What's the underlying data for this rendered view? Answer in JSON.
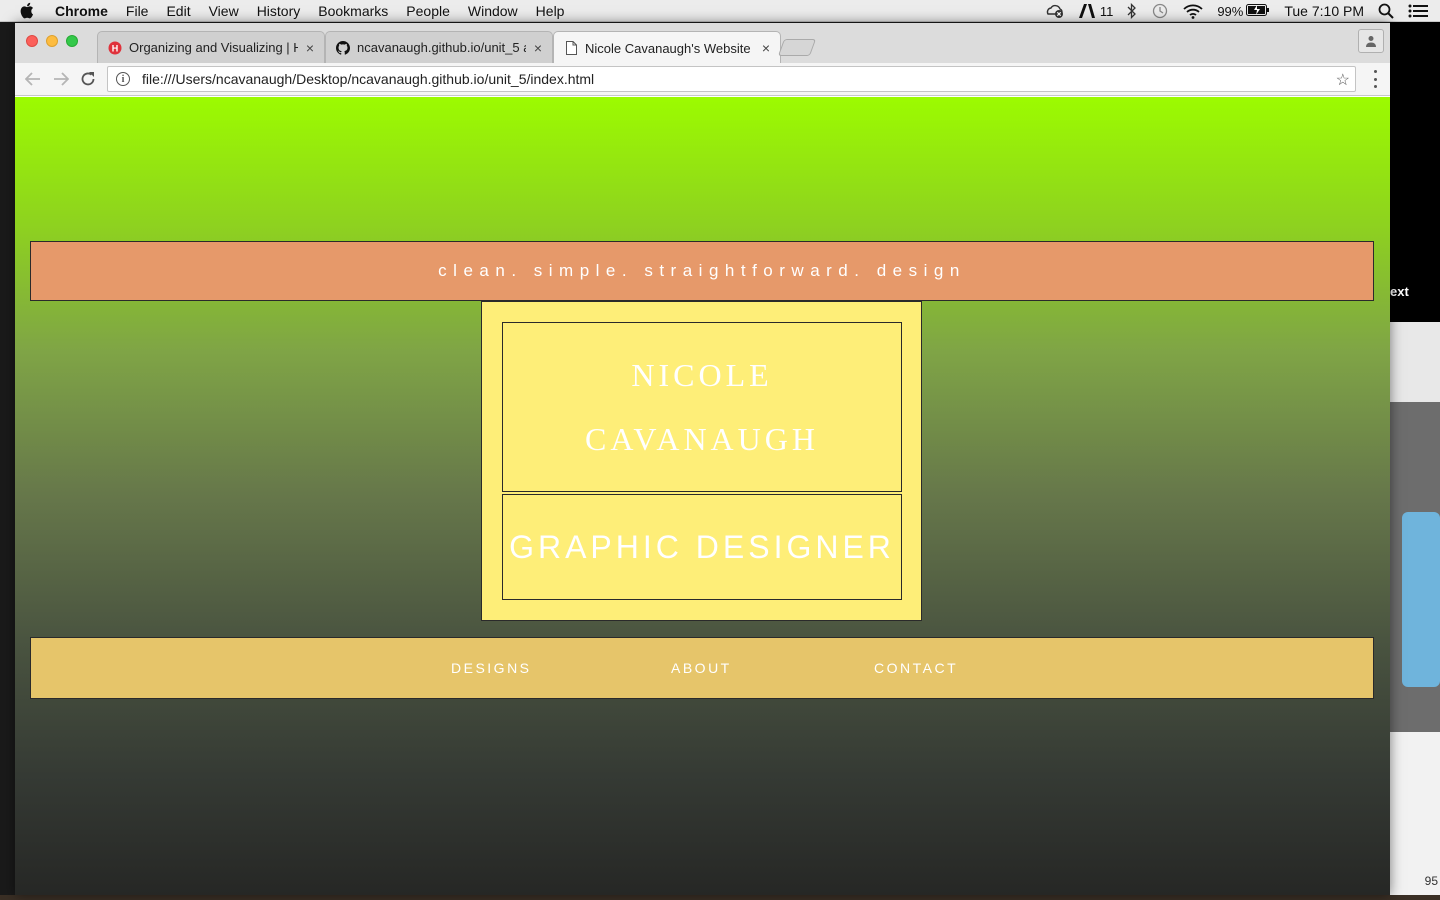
{
  "menubar": {
    "apple_icon": "apple-icon",
    "app_name": "Chrome",
    "items": [
      "File",
      "Edit",
      "View",
      "History",
      "Bookmarks",
      "People",
      "Window",
      "Help"
    ],
    "status": {
      "adobe_count": "11",
      "battery": "99%",
      "clock": "Tue 7:10 PM"
    }
  },
  "browser": {
    "tabs": [
      {
        "title": "Organizing and Visualizing | H",
        "icon": "site-favicon-icon",
        "close": "×"
      },
      {
        "title": "ncavanaugh.github.io/unit_5 at",
        "icon": "github-icon",
        "close": "×"
      },
      {
        "title": "Nicole Cavanaugh's Website",
        "icon": "page-icon",
        "close": "×"
      }
    ],
    "url": "file:///Users/ncavanaugh/Desktop/ncavanaugh.github.io/unit_5/index.html"
  },
  "site": {
    "tagline": "clean. simple. straightforward. design",
    "name_line1": "NICOLE",
    "name_line2": "CAVANAUGH",
    "role": "GRAPHIC DESIGNER",
    "nav": [
      "DESIGNS",
      "ABOUT",
      "CONTACT"
    ]
  },
  "background": {
    "sidebar_text": "ext",
    "number": "95"
  },
  "colors": {
    "gradient_top": "#9cfb00",
    "gradient_bottom": "#262725",
    "tagline_bar": "#e6996a",
    "name_card": "#feee78",
    "nav_bar": "#e6c56a"
  }
}
